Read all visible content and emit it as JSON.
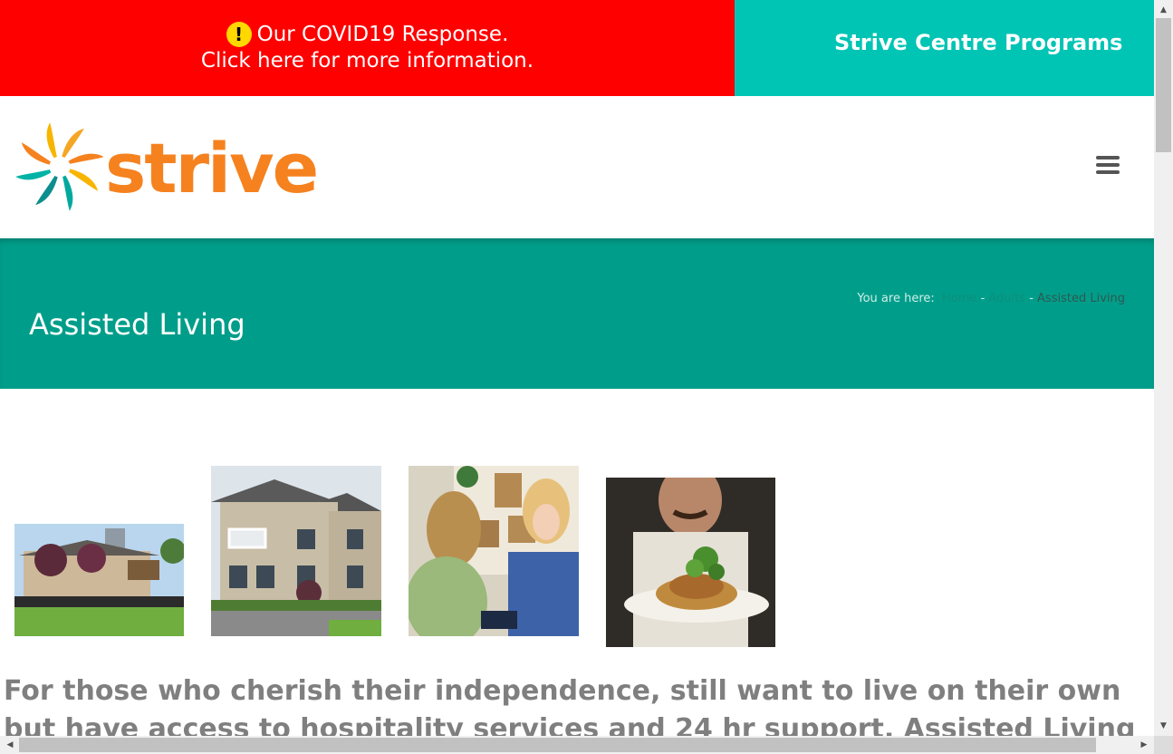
{
  "covid": {
    "icon": "exclamation-circle-icon",
    "alert_glyph": "!",
    "line1": "Our COVID19 Response.",
    "line2": "Click here for more information."
  },
  "programs_bar": {
    "label": "Strive Centre Programs"
  },
  "logo": {
    "text": "strive",
    "icon": "pinwheel-logo-icon"
  },
  "menu": {
    "icon": "hamburger-menu-icon"
  },
  "page": {
    "title": "Assisted Living"
  },
  "breadcrumb": {
    "prefix": "You are here:",
    "items": [
      "Home",
      "Adults",
      "Assisted Living"
    ],
    "separator": "-"
  },
  "gallery": [
    {
      "name": "building-exterior-photo"
    },
    {
      "name": "residence-building-photo"
    },
    {
      "name": "nurse-visit-photo"
    },
    {
      "name": "chef-plated-meal-photo"
    }
  ],
  "intro": "For those who cherish their independence, still want to live on their own but have access to hospitality services and 24 hr support, Assisted Living may be the best",
  "colors": {
    "covid_red": "#ff0000",
    "programs_teal": "#00c4b4",
    "title_band": "#009e8a",
    "logo_orange": "#f5821f"
  }
}
